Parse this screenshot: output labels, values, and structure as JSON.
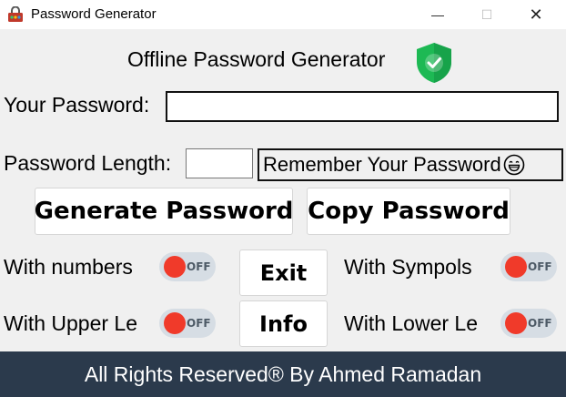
{
  "window": {
    "title": "Password Generator",
    "minimize_glyph": "—",
    "maximize_glyph": "☐",
    "close_glyph": "✕",
    "app_icon": "lock-gear-icon"
  },
  "header": {
    "title": "Offline Password Generator",
    "icon": "shield-check-icon",
    "shield_color": "#1db954"
  },
  "password": {
    "label": "Your Password:",
    "value": ""
  },
  "length": {
    "label": "Password Length:",
    "value": ""
  },
  "remember": {
    "text": "Remember Your Password",
    "icon": "grinning-face-icon"
  },
  "buttons": {
    "generate": "Generate Password",
    "copy": "Copy Password",
    "exit": "Exit",
    "info": "Info"
  },
  "options": {
    "numbers": {
      "label": "With numbers",
      "state": "OFF"
    },
    "symbols": {
      "label": "With Sympols",
      "state": "OFF"
    },
    "upper": {
      "label": "With Upper Le",
      "state": "OFF"
    },
    "lower": {
      "label": "With Lower Le",
      "state": "OFF"
    }
  },
  "colors": {
    "toggle_knob": "#f03a2a",
    "toggle_track": "#d6dde4",
    "footer_bg": "#2b3a4c"
  },
  "footer": {
    "text": "All Rights Reserved® By Ahmed Ramadan"
  }
}
